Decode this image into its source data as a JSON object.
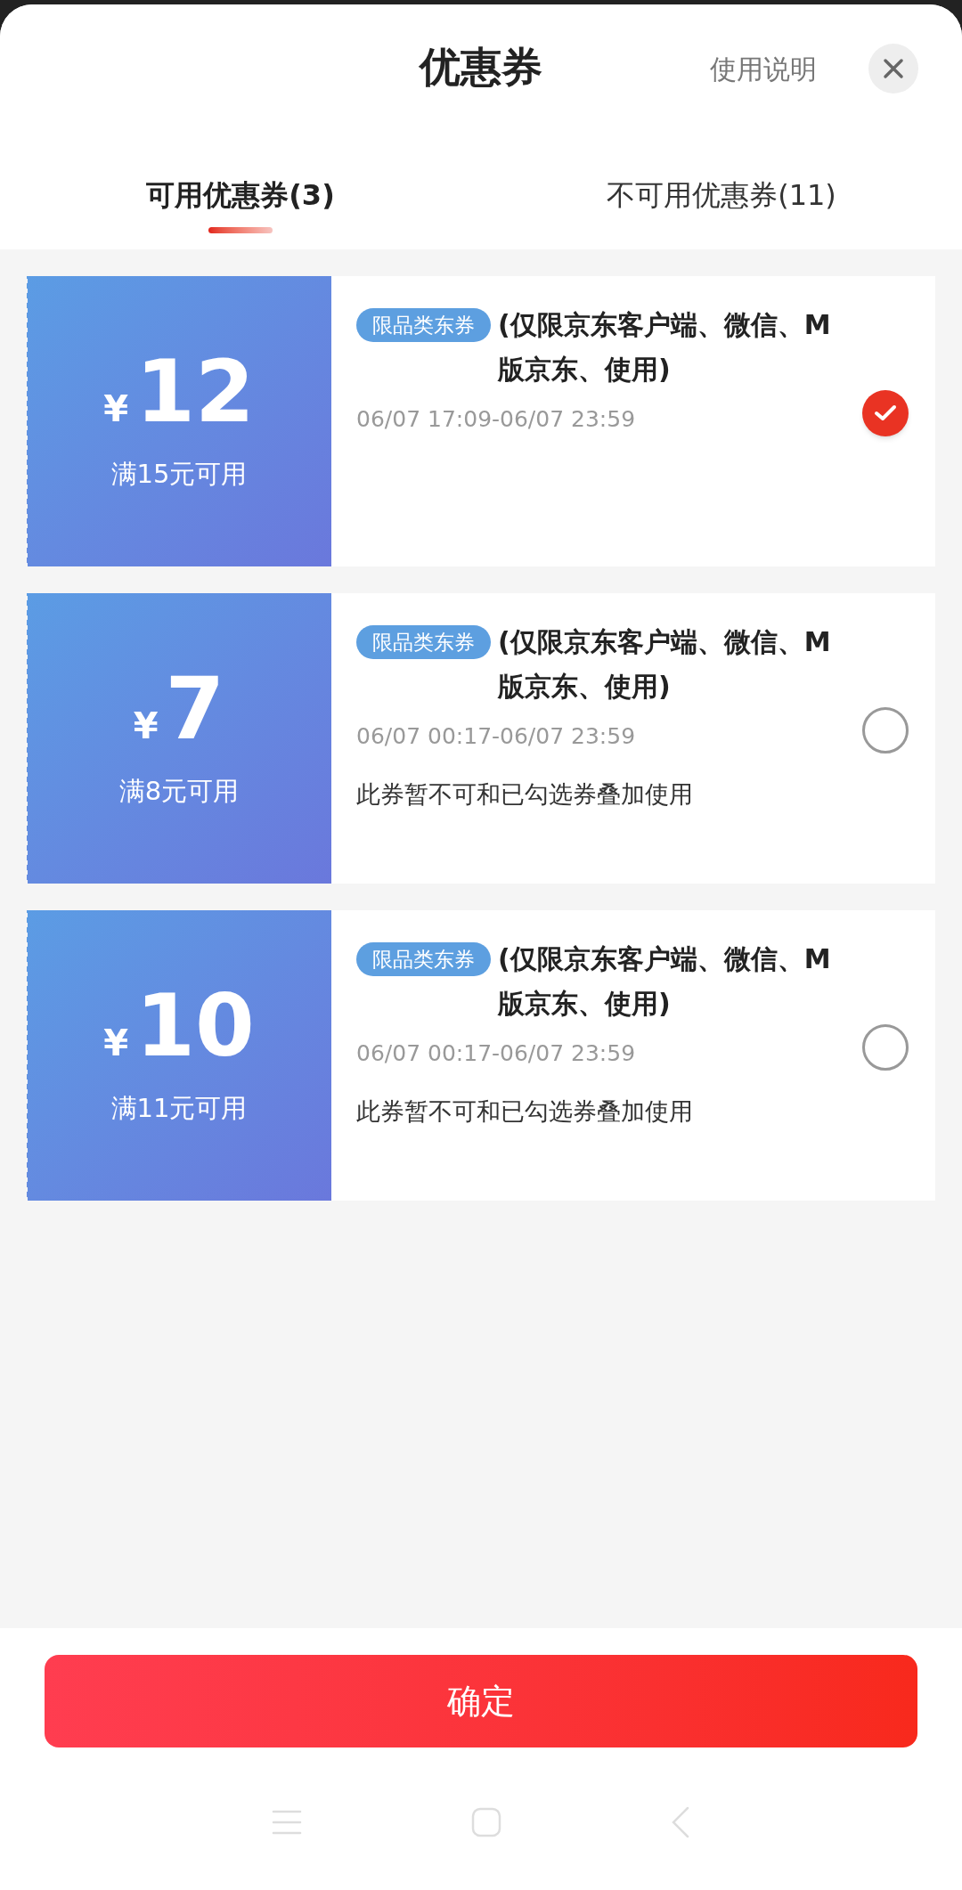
{
  "header": {
    "title": "优惠券",
    "help_link": "使用说明"
  },
  "tabs": [
    {
      "label": "可用优惠券(3)",
      "selected": true
    },
    {
      "label": "不可用优惠券(11)",
      "selected": false
    }
  ],
  "coupons": [
    {
      "currency": "¥",
      "amount": "12",
      "condition": "满15元可用",
      "tag": "限品类东券",
      "title": "(仅限京东客户端、微信、M版京东、使用)",
      "validity": "06/07 17:09-06/07 23:59",
      "selected": true
    },
    {
      "currency": "¥",
      "amount": "7",
      "condition": "满8元可用",
      "tag": "限品类东券",
      "title": "(仅限京东客户端、微信、M版京东、使用)",
      "validity": "06/07 00:17-06/07 23:59",
      "note": "此券暂不可和已勾选券叠加使用",
      "selected": false
    },
    {
      "currency": "¥",
      "amount": "10",
      "condition": "满11元可用",
      "tag": "限品类东券",
      "title": "(仅限京东客户端、微信、M版京东、使用)",
      "validity": "06/07 00:17-06/07 23:59",
      "note": "此券暂不可和已勾选券叠加使用",
      "selected": false
    }
  ],
  "confirm_button": "确定"
}
